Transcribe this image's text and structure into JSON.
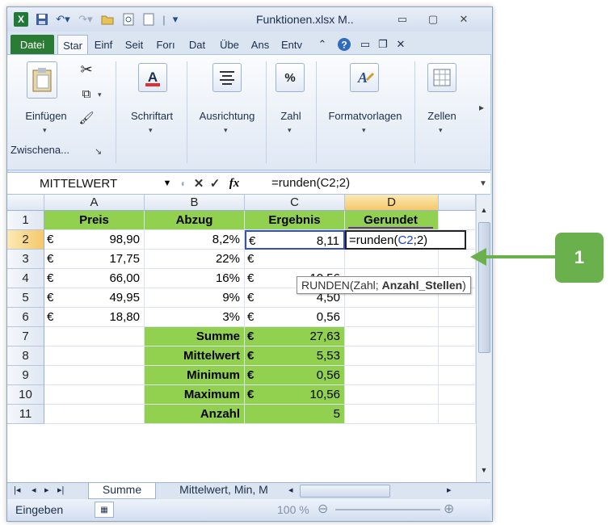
{
  "window": {
    "title": "Funktionen.xlsx M.."
  },
  "ribbon_tabs": [
    "Datei",
    "Star",
    "Einf",
    "Seit",
    "Forı",
    "Dat",
    "Übe",
    "Ans",
    "Entv"
  ],
  "ribbon": {
    "clipboard": {
      "paste_label": "Einfügen",
      "group_label": "Zwischena..."
    },
    "font_label": "Schriftart",
    "align_label": "Ausrichtung",
    "number_label": "Zahl",
    "styles_label": "Formatvorlagen",
    "cells_label": "Zellen"
  },
  "formula_bar": {
    "name_box": "MITTELWERT",
    "fx": "fx",
    "formula": "=runden(C2;2)"
  },
  "columns": [
    "A",
    "B",
    "C",
    "D"
  ],
  "rows": [
    "1",
    "2",
    "3",
    "4",
    "5",
    "6",
    "7",
    "8",
    "9",
    "10",
    "11"
  ],
  "headers": {
    "A": "Preis",
    "B": "Abzug",
    "C": "Ergebnis",
    "D": "Gerundet"
  },
  "currency": "€",
  "data": [
    {
      "preis": "98,90",
      "abzug": "8,2%",
      "ergebnis": "8,11"
    },
    {
      "preis": "17,75",
      "abzug": "22%",
      "ergebnis": ""
    },
    {
      "preis": "66,00",
      "abzug": "16%",
      "ergebnis": "10,56"
    },
    {
      "preis": "49,95",
      "abzug": "9%",
      "ergebnis": "4,50"
    },
    {
      "preis": "18,80",
      "abzug": "3%",
      "ergebnis": "0,56"
    }
  ],
  "stats": [
    {
      "label": "Summe",
      "currency": "€",
      "value": "27,63"
    },
    {
      "label": "Mittelwert",
      "currency": "€",
      "value": "5,53"
    },
    {
      "label": "Minimum",
      "currency": "€",
      "value": "0,56"
    },
    {
      "label": "Maximum",
      "currency": "€",
      "value": "10,56"
    },
    {
      "label": "Anzahl",
      "currency": "",
      "value": "5"
    }
  ],
  "edit": {
    "prefix": "=runden(",
    "ref": "C2",
    "suffix": ";2)",
    "ref_color": "#1f3fd0"
  },
  "tooltip": {
    "func": "RUNDEN(Zahl; ",
    "arg": "Anzahl_Stellen",
    "close": ")"
  },
  "sheet_tabs": [
    "Summe",
    "Mittelwert, Min, M"
  ],
  "status": {
    "mode": "Eingeben",
    "zoom": "100 %"
  },
  "callout": {
    "number": "1",
    "color": "#6ab04c"
  }
}
